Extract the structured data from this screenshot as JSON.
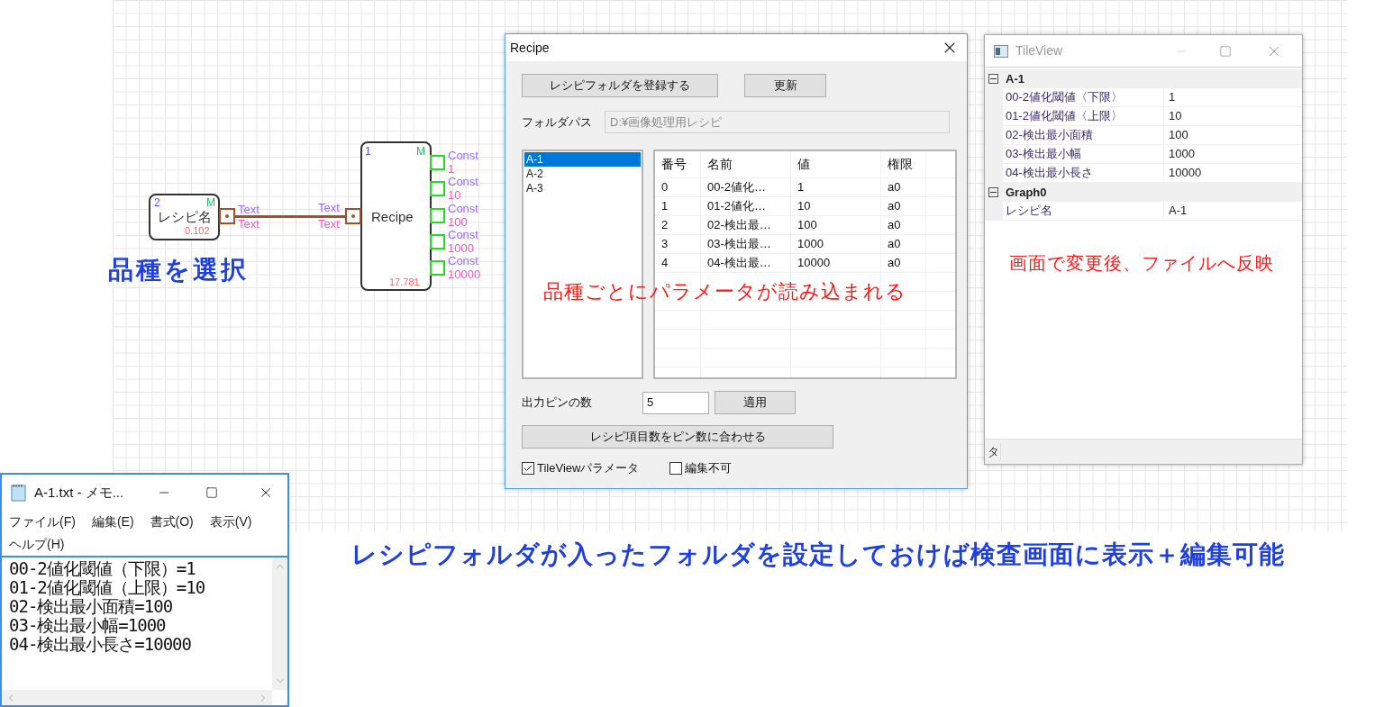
{
  "canvas": {
    "nodes": [
      {
        "kind": "source",
        "number": "2",
        "mode": "M",
        "label": "レシピ名",
        "time": "0.102",
        "outputs": [
          {
            "type": "Text",
            "value": "Text"
          }
        ]
      },
      {
        "kind": "recipe",
        "number": "1",
        "mode": "M",
        "label": "Recipe",
        "time": "17.781",
        "inputs": [
          {
            "type": "Text",
            "value": "Text"
          }
        ],
        "outputs": [
          {
            "type": "Const",
            "value": "1"
          },
          {
            "type": "Const",
            "value": "10"
          },
          {
            "type": "Const",
            "value": "100"
          },
          {
            "type": "Const",
            "value": "1000"
          },
          {
            "type": "Const",
            "value": "10000"
          }
        ]
      }
    ]
  },
  "recipe_dialog": {
    "title": "Recipe",
    "register_button": "レシピフォルダを登録する",
    "refresh_button": "更新",
    "folder_label": "フォルダパス",
    "folder_path": "D:¥画像処理用レシピ",
    "list": [
      {
        "label": "A-1",
        "selected": true
      },
      {
        "label": "A-2",
        "selected": false
      },
      {
        "label": "A-3",
        "selected": false
      }
    ],
    "table": {
      "columns": [
        "番号",
        "名前",
        "値",
        "権限"
      ],
      "rows": [
        [
          "0",
          "00-2値化…",
          "1",
          "a0"
        ],
        [
          "1",
          "01-2値化…",
          "10",
          "a0"
        ],
        [
          "2",
          "02-検出最…",
          "100",
          "a0"
        ],
        [
          "3",
          "03-検出最…",
          "1000",
          "a0"
        ],
        [
          "4",
          "04-検出最…",
          "10000",
          "a0"
        ]
      ]
    },
    "pin_label": "出力ピンの数",
    "pin_count": "5",
    "apply_button": "適用",
    "match_button": "レシピ項目数をピン数に合わせる",
    "checkboxes": [
      {
        "label": "TileViewパラメータ",
        "checked": true
      },
      {
        "label": "編集不可",
        "checked": false
      }
    ]
  },
  "tileview": {
    "title": "TileView",
    "groups": [
      {
        "name": "A-1",
        "expanded": true,
        "rows": [
          {
            "name": "00-2値化閾値〈下限〉",
            "value": "1"
          },
          {
            "name": "01-2値化閾値〈上限〉",
            "value": "10"
          },
          {
            "name": "02-検出最小面積",
            "value": "100"
          },
          {
            "name": "03-検出最小幅",
            "value": "1000"
          },
          {
            "name": "04-検出最小長さ",
            "value": "10000"
          }
        ]
      },
      {
        "name": "Graph0",
        "expanded": true,
        "rows": [
          {
            "name": "レシピ名",
            "value": "A-1"
          }
        ]
      }
    ],
    "status": "タ"
  },
  "notepad": {
    "title": "A-1.txt - メモ...",
    "menu": [
      "ファイル(F)",
      "編集(E)",
      "書式(O)",
      "表示(V)",
      "ヘルプ(H)"
    ],
    "lines": [
      "00-2値化閾値（下限）=1",
      "01-2値化閾値（上限）=10",
      "02-検出最小面積=100",
      "03-検出最小幅=1000",
      "04-検出最小長さ=10000"
    ]
  },
  "annotations": [
    {
      "text": "品種を選択",
      "color": "#1f3fe0"
    },
    {
      "text": "品種ごとにパラメータが読み込まれる",
      "color": "#ff1a1a"
    },
    {
      "text": "画面で変更後、ファイルへ反映",
      "color": "#ff1a1a"
    },
    {
      "text": "レシピフォルダが入ったフォルダを設定しておけば検査画面に表示＋編集可能",
      "color": "#1f3fe0"
    }
  ]
}
